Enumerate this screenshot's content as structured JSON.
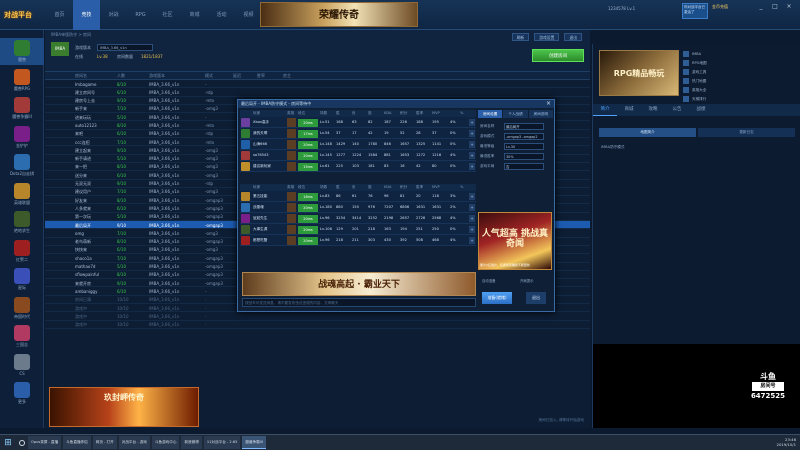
{
  "app": {
    "logo": "对战平台",
    "nav": [
      "首页",
      "竞技",
      "对战",
      "RPG",
      "社区",
      "商城",
      "活动",
      "视频",
      "发现"
    ],
    "active_nav": 1,
    "banner": "荣耀传奇",
    "user": {
      "name": "1234578",
      "level": "Lv.1"
    },
    "promo": "你对战平台已激活了",
    "gold": "金币充值",
    "window_controls": [
      "_",
      "□",
      "×"
    ]
  },
  "sidebar": [
    {
      "label": "魔兽",
      "color": "#2e7d32"
    },
    {
      "label": "魔兽RPG",
      "color": "#c2571f"
    },
    {
      "label": "魔兽争霸III",
      "color": "#a33a3a"
    },
    {
      "label": "金铲铲",
      "color": "#7a1f8a"
    },
    {
      "label": "Dota2自走棋",
      "color": "#2c6db0"
    },
    {
      "label": "英雄联盟",
      "color": "#b8862a"
    },
    {
      "label": "绝地求生",
      "color": "#3d5a2a"
    },
    {
      "label": "红警二",
      "color": "#9e1f1f"
    },
    {
      "label": "星际",
      "color": "#3b4fb8"
    },
    {
      "label": "帝国时代",
      "color": "#8a4a1f"
    },
    {
      "label": "三国志",
      "color": "#b03a62"
    },
    {
      "label": "CS",
      "color": "#6b7b8c"
    },
    {
      "label": "更多",
      "color": "#2a5ea8"
    }
  ],
  "game_header": {
    "path": "IMBA单版防守 > 房间",
    "logo": "IMBA",
    "version_label": "游戏版本",
    "version_value": "IMBA_3.66_v1n",
    "online_label": "在线",
    "online_value": "Lv.38",
    "rooms_label": "房间数量",
    "rooms_value": "1821/1837",
    "buttons": [
      "刷新",
      "游戏设置",
      "退出"
    ],
    "create_room": "创建房间"
  },
  "columns": [
    "房间名",
    "人数",
    "游戏版本",
    "模式",
    "延迟",
    "胜率",
    "房主"
  ],
  "rooms": [
    {
      "name": "Imbagame",
      "count": "8/10",
      "ver": "IMBA_3.66_v1n",
      "mode": "-",
      "state": ""
    },
    {
      "name": "建立房间号",
      "count": "6/10",
      "ver": "IMBA_3.66_v1n",
      "mode": "-rdp",
      "state": ""
    },
    {
      "name": "建房号上去",
      "count": "9/10",
      "ver": "IMBA_3.66_v1n",
      "mode": "-mtx",
      "state": ""
    },
    {
      "name": "新手来",
      "count": "7/10",
      "ver": "IMBA_3.66_v1n",
      "mode": "-omg3",
      "state": ""
    },
    {
      "name": "进来玩玩",
      "count": "5/10",
      "ver": "IMBA_3.66_v1n",
      "mode": "-",
      "state": ""
    },
    {
      "name": "auto12123",
      "count": "8/10",
      "ver": "IMBA_3.66_v1n",
      "mode": "-mtx",
      "state": ""
    },
    {
      "name": "来吧",
      "count": "6/10",
      "ver": "IMBA_3.66_v1n",
      "mode": "-rdp",
      "state": ""
    },
    {
      "name": "ccc连招",
      "count": "7/10",
      "ver": "IMBA_3.66_v1n",
      "mode": "-mtx",
      "state": ""
    },
    {
      "name": "建立起来",
      "count": "9/10",
      "ver": "IMBA_3.66_v1n",
      "mode": "-omg3",
      "state": ""
    },
    {
      "name": "新手请进",
      "count": "5/10",
      "ver": "IMBA_3.66_v1n",
      "mode": "-omg3",
      "state": ""
    },
    {
      "name": "来一把",
      "count": "8/10",
      "ver": "IMBA_3.66_v1n",
      "mode": "-omg3",
      "state": ""
    },
    {
      "name": "送分来",
      "count": "6/10",
      "ver": "IMBA_3.66_v1n",
      "mode": "-omg3",
      "state": ""
    },
    {
      "name": "无双无双",
      "count": "9/10",
      "ver": "IMBA_3.66_v1n",
      "mode": "-rdp",
      "state": ""
    },
    {
      "name": "建议用户",
      "count": "7/10",
      "ver": "IMBA_3.66_v1n",
      "mode": "-omg3",
      "state": ""
    },
    {
      "name": "好友来",
      "count": "8/10",
      "ver": "IMBA_3.66_v1n",
      "mode": "-omgap3",
      "state": ""
    },
    {
      "name": "人多就来",
      "count": "6/10",
      "ver": "IMBA_3.66_v1n",
      "mode": "-omgap3",
      "state": ""
    },
    {
      "name": "第一次玩",
      "count": "5/10",
      "ver": "IMBA_3.66_v1n",
      "mode": "-omgap3",
      "state": ""
    },
    {
      "name": "最后局开",
      "count": "9/10",
      "ver": "IMBA_3.66_v1n",
      "mode": "-omgap3",
      "state": "sel"
    },
    {
      "name": "omg",
      "count": "7/10",
      "ver": "IMBA_3.66_v1n",
      "mode": "-omg3",
      "state": ""
    },
    {
      "name": "老鸟萌新",
      "count": "8/10",
      "ver": "IMBA_3.66_v1n",
      "mode": "-omgap3",
      "state": ""
    },
    {
      "name": "快快来",
      "count": "6/10",
      "ver": "IMBA_3.66_v1n",
      "mode": "-omg3",
      "state": ""
    },
    {
      "name": "shaco1a",
      "count": "7/10",
      "ver": "IMBA_3.66_v1n",
      "mode": "-omgap3",
      "state": ""
    },
    {
      "name": "mathao7d",
      "count": "5/10",
      "ver": "IMBA_3.66_v1n",
      "mode": "-omgap3",
      "state": ""
    },
    {
      "name": "sflowpainful",
      "count": "8/10",
      "ver": "IMBA_3.66_v1n",
      "mode": "-omgap3",
      "state": ""
    },
    {
      "name": "来就开房",
      "count": "9/10",
      "ver": "IMBA_3.66_v1n",
      "mode": "-omgap3",
      "state": ""
    },
    {
      "name": "ambaniggy",
      "count": "6/10",
      "ver": "IMBA_3.66_v1n",
      "mode": "-",
      "state": ""
    },
    {
      "name": "房间已满",
      "count": "10/10",
      "ver": "IMBA_3.66_v1n",
      "mode": "-",
      "state": "dim"
    },
    {
      "name": "游戏中",
      "count": "10/10",
      "ver": "IMBA_3.66_v1n",
      "mode": "-",
      "state": "dim"
    },
    {
      "name": "游戏中",
      "count": "10/10",
      "ver": "IMBA_3.66_v1n",
      "mode": "-",
      "state": "dim"
    },
    {
      "name": "游戏中",
      "count": "10/10",
      "ver": "IMBA_3.66_v1n",
      "mode": "-",
      "state": "dim"
    }
  ],
  "left_ad": "玖封岬传奇",
  "status_line": "房间已加入, 请等待开始游戏",
  "modal": {
    "title": "最后局开 - IMBA防守模式 - 房间等待中",
    "team_header": [
      "玩家",
      "英雄",
      "段位",
      "场数",
      "胜",
      "负",
      "逃",
      "KDA",
      "积分",
      "胜率",
      "MVP",
      "%"
    ],
    "team1": [
      {
        "name": "Xbox高手",
        "rank": "20ms",
        "lv": "Lv.51",
        "s": [
          "168",
          "63",
          "82",
          "187",
          "226",
          "188",
          "195",
          "4%"
        ],
        "color": "#6b3fa0"
      },
      {
        "name": "我的天啊",
        "rank": "17ms",
        "lv": "Lv.54",
        "s": [
          "37",
          "17",
          "42",
          "19",
          "52",
          "28",
          "37",
          "0%"
        ],
        "color": "#2e7d32"
      },
      {
        "name": "山海666",
        "rank": "20ms",
        "lv": "Lv.148",
        "s": [
          "1429",
          "140",
          "1780",
          "846",
          "1657",
          "1325",
          "1141",
          "0%"
        ],
        "color": "#1f5fa8"
      },
      {
        "name": "sa76543",
        "rank": "20ms",
        "lv": "Lv.145",
        "s": [
          "1277",
          "1224",
          "1584",
          "881",
          "1653",
          "1272",
          "1216",
          "4%"
        ],
        "color": "#a33a3a"
      },
      {
        "name": "建议新玩家",
        "rank": "15ms",
        "lv": "Lv.61",
        "s": [
          "225",
          "103",
          "181",
          "83",
          "16",
          "42",
          "80",
          "0%"
        ],
        "color": "#c08f2a"
      }
    ],
    "team2": [
      {
        "name": "第五技能",
        "rank": "18ms",
        "lv": "Lv.83",
        "s": [
          "86",
          "61",
          "76",
          "96",
          "81",
          "20",
          "118",
          "3%"
        ],
        "color": "#b8862a"
      },
      {
        "name": "战墨魂",
        "rank": "20ms",
        "lv": "Lv.180",
        "s": [
          "880",
          "150",
          "976",
          "7207",
          "6806",
          "1631",
          "1631",
          "2%"
        ],
        "color": "#2c6db0"
      },
      {
        "name": "屁屁先生",
        "rank": "20ms",
        "lv": "Lv.96",
        "s": [
          "3254",
          "3414",
          "3252",
          "2198",
          "2657",
          "2728",
          "2568",
          "4%"
        ],
        "color": "#7a1f8a"
      },
      {
        "name": "大事生源",
        "rank": "20ms",
        "lv": "Lv.106",
        "s": [
          "129",
          "201",
          "218",
          "163",
          "194",
          "251",
          "250",
          "0%"
        ],
        "color": "#3d5a2a"
      },
      {
        "name": "都是吃醋",
        "rank": "20ms",
        "lv": "Lv.96",
        "s": [
          "218",
          "211",
          "303",
          "430",
          "392",
          "508",
          "468",
          "4%"
        ],
        "color": "#9e1f1f"
      }
    ],
    "ad": "战魂高起 · 霸业天下",
    "chat_placeholder": "按回车可发送消息，请不要发布违法违规的内容，文明聊天",
    "side_tabs": [
      "房间设置",
      "个人战绩",
      "房间说明"
    ],
    "fields": [
      {
        "label": "房间名称",
        "value": "最后局开"
      },
      {
        "label": "游戏模式",
        "value": "-omgap3 -omgap2"
      },
      {
        "label": "最低等级",
        "value": "Lv.30"
      },
      {
        "label": "最低胜率",
        "value": "30%"
      },
      {
        "label": "游戏平局",
        "value": "否"
      }
    ],
    "side_ad": "人气超高 挑战真奇闻",
    "side_note": "累计2亿用户，玩游戏就赚钱不断更新",
    "checks": [
      "自动准备",
      "开局提示"
    ],
    "ready": "准备(就绪)",
    "exit": "退出"
  },
  "right_panel": {
    "ad": "RPG精品畅玩",
    "links": [
      "IMBA",
      "RPG地图",
      "游戏工具",
      "热门地图",
      "英雄大全",
      "天梯排行",
      "战绩查询"
    ],
    "tabs": [
      "简介",
      "商城",
      "攻略",
      "公告",
      "战绩"
    ],
    "subtabs": [
      "地图简介",
      "更新日志"
    ],
    "text": "IMBA防守模式",
    "watermark": "斗鱼",
    "watermark_sub": "房间号",
    "watermark_num": "6472525"
  },
  "taskbar": {
    "start": "⊞",
    "tasks": [
      "Opus录屏 - 直播",
      "斗鱼直播伴侣",
      "网页 - 打开",
      "对战平台 - 游戏",
      "斗鱼游戏中心",
      "新浪微博",
      "11对战平台 - 2.65",
      "魔兽争霸III"
    ],
    "active_task": 7,
    "time": "23:46",
    "date": "2019/10/1"
  }
}
